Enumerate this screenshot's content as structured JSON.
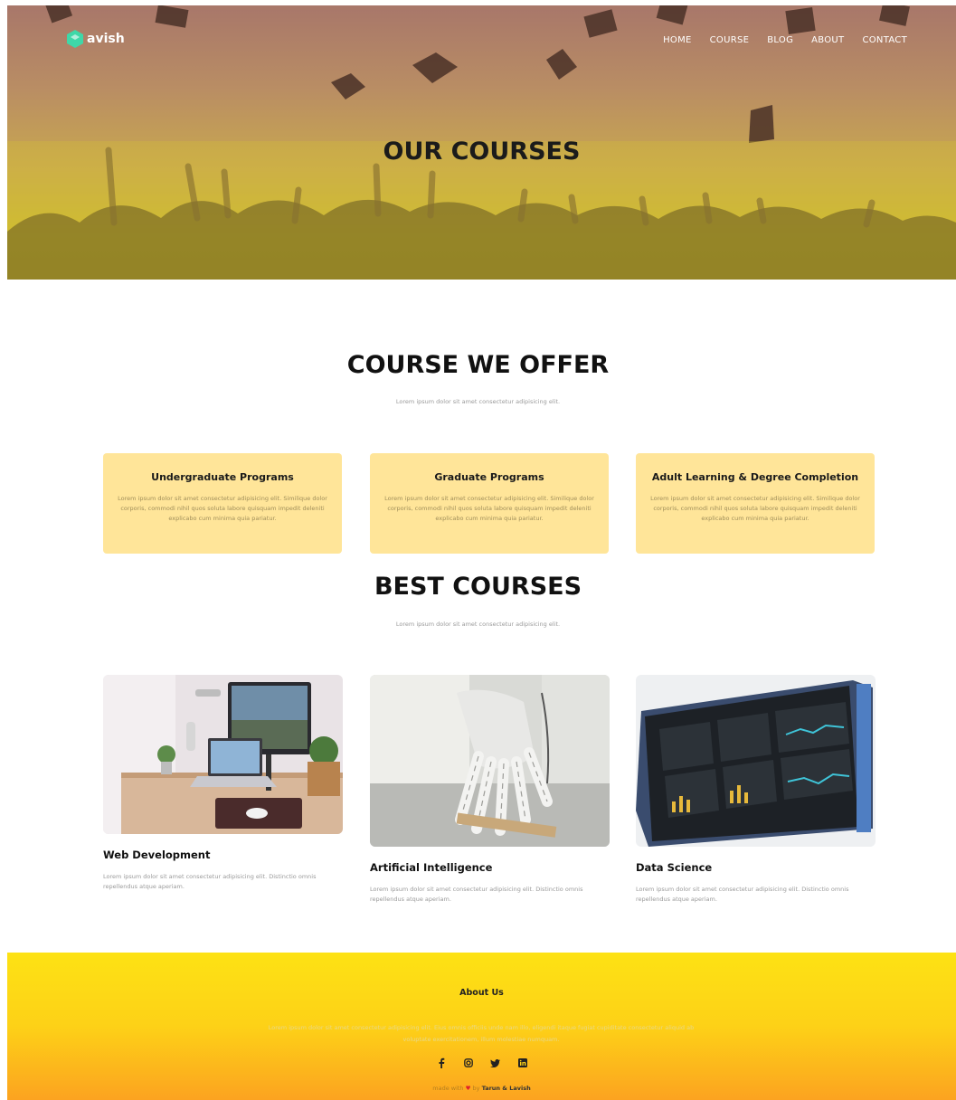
{
  "brand": {
    "logo_text": "avish",
    "logo_color": "#3fd8a8"
  },
  "nav": {
    "items": [
      "HOME",
      "COURSE",
      "BLOG",
      "ABOUT",
      "CONTACT"
    ]
  },
  "hero": {
    "title": "OUR COURSES"
  },
  "offer": {
    "title": "COURSE WE OFFER",
    "subtitle": "Lorem ipsum dolor sit amet consectetur adipisicing elit.",
    "cards": [
      {
        "title": "Undergraduate Programs",
        "body": "Lorem ipsum dolor sit amet consectetur adipisicing elit. Similique dolor corporis, commodi nihil quos soluta labore quisquam impedit deleniti explicabo cum minima quia pariatur."
      },
      {
        "title": "Graduate Programs",
        "body": "Lorem ipsum dolor sit amet consectetur adipisicing elit. Similique dolor corporis, commodi nihil quos soluta labore quisquam impedit deleniti explicabo cum minima quia pariatur."
      },
      {
        "title": "Adult Learning & Degree Completion",
        "body": "Lorem ipsum dolor sit amet consectetur adipisicing elit. Similique dolor corporis, commodi nihil quos soluta labore quisquam impedit deleniti explicabo cum minima quia pariatur."
      }
    ]
  },
  "best": {
    "title": "BEST COURSES",
    "subtitle": "Lorem ipsum dolor sit amet consectetur adipisicing elit.",
    "courses": [
      {
        "title": "Web Development",
        "body": "Lorem ipsum dolor sit amet consectetur adipisicing elit. Distinctio omnis repellendus atque aperiam."
      },
      {
        "title": "Artificial Intelligence",
        "body": "Lorem ipsum dolor sit amet consectetur adipisicing elit. Distinctio omnis repellendus atque aperiam."
      },
      {
        "title": "Data Science",
        "body": "Lorem ipsum dolor sit amet consectetur adipisicing elit. Distinctio omnis repellendus atque aperiam."
      }
    ]
  },
  "footer": {
    "title": "About Us",
    "body": "Lorem ipsum dolor sit amet consectetur adipisicing elit. Eius omnis officiis unde nam illo, eligendi itaque fugiat cupiditate consectetur aliquid ab voluptate exercitationem, illum molestiae numquam.",
    "social_icons": [
      "facebook-icon",
      "instagram-icon",
      "twitter-icon",
      "linkedin-icon"
    ],
    "credit_prefix": "made with",
    "credit_by": "by",
    "credit_name": "Tarun & Lavish"
  }
}
